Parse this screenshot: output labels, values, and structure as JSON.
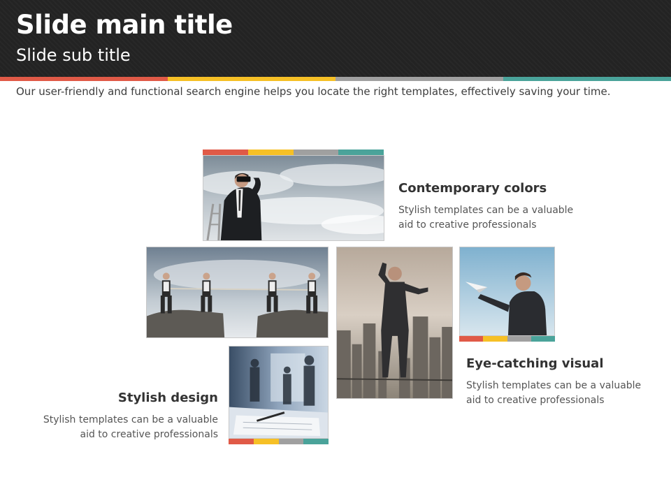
{
  "header": {
    "title": "Slide main title",
    "subtitle": "Slide sub title"
  },
  "stripe_colors": [
    "#e05a47",
    "#f6c026",
    "#a0a0a0",
    "#4aa39a"
  ],
  "description": "Our user-friendly and functional search engine helps you locate the right templates, effectively saving your time.",
  "features": [
    {
      "title": "Contemporary colors",
      "line1": "Stylish templates can be a valuable",
      "line2": "aid to creative professionals"
    },
    {
      "title": "Eye-catching visual",
      "line1": "Stylish templates can be a valuable",
      "line2": "aid to creative professionals"
    },
    {
      "title": "Stylish design",
      "line1": "Stylish templates can be a valuable",
      "line2": "aid to creative professionals"
    }
  ]
}
